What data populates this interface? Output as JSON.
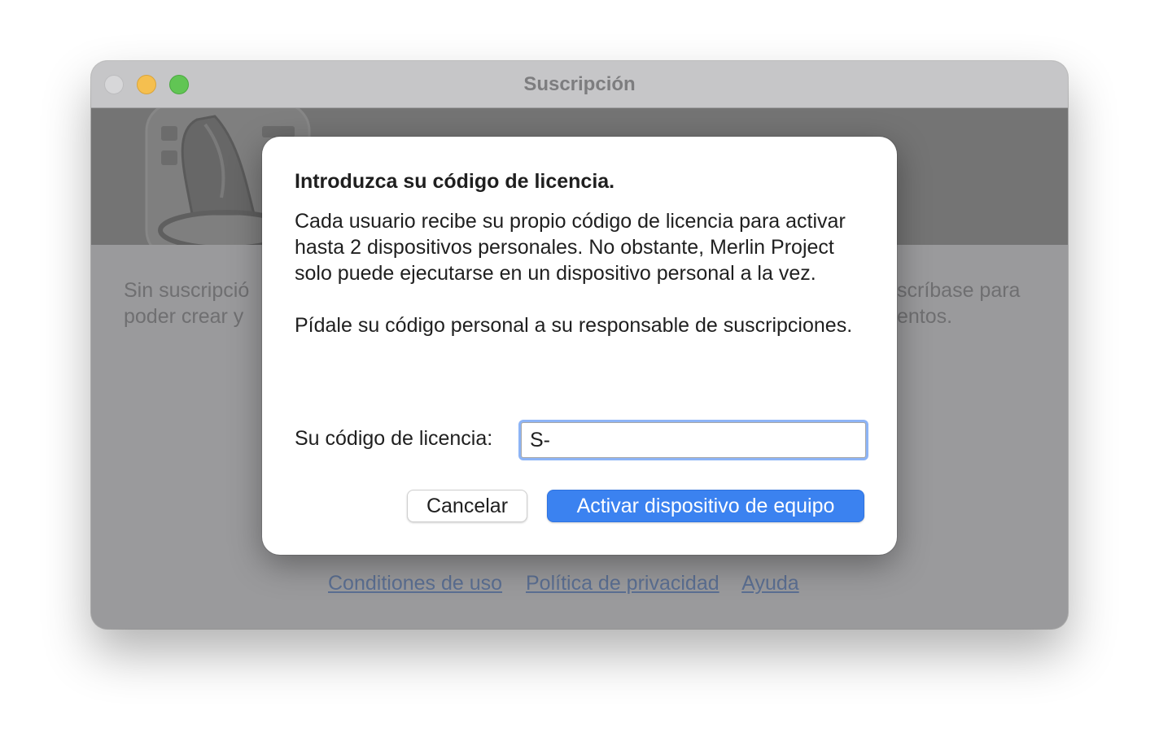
{
  "window": {
    "title": "Suscripción"
  },
  "background": {
    "text_left_lines": [
      "Sin suscripció",
      "poder crear y"
    ],
    "text_right_lines": [
      "scríbase para",
      "entos."
    ],
    "links": {
      "terms": "Conditiones de uso",
      "privacy": "Política de privacidad",
      "help": "Ayuda"
    }
  },
  "dialog": {
    "title": "Introduzca su código de licencia.",
    "paragraph1": "Cada usuario recibe su propio código de licencia para activar hasta 2 dispositivos personales. No obstante, Merlin Project solo puede ejecutarse en un dispositivo personal a la vez.",
    "paragraph2": "Pídale su código personal a su responsable de suscripciones.",
    "field_label": "Su código de licencia:",
    "license_value": "S-",
    "cancel_label": "Cancelar",
    "activate_label": "Activar dispositivo de equipo"
  },
  "colors": {
    "primary_button": "#3b82f0",
    "focus_ring": "#8db4f6",
    "traffic_close": "#d7d7d9",
    "traffic_minimize": "#f5bf4f",
    "traffic_zoom": "#61c554"
  },
  "icons": {
    "app_logo": "merlin-wizard-hat-icon"
  }
}
